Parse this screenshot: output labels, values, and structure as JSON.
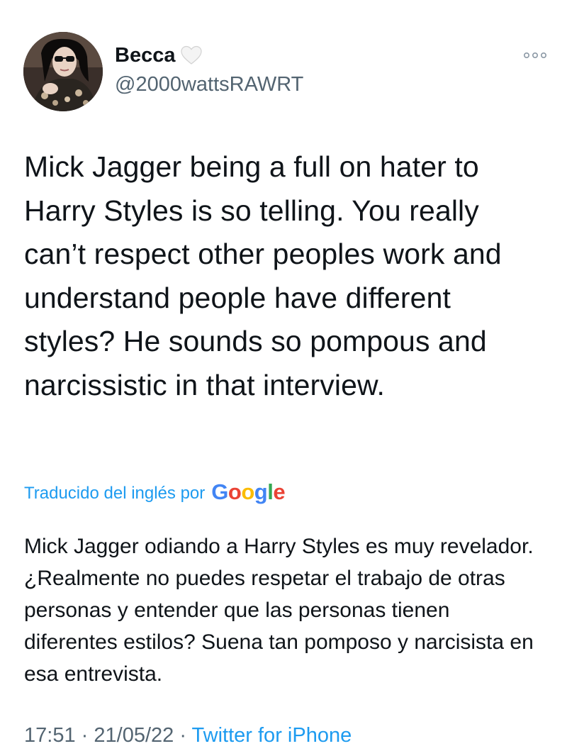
{
  "author": {
    "display_name": "Becca",
    "handle": "@2000wattsRAWRT",
    "name_emoji": "white-heart-icon"
  },
  "tweet": {
    "text": "Mick Jagger being a full on hater to Harry Styles is so telling. You really can’t respect other peoples work and understand people have different styles? He sounds so pompous and narcissistic in that interview."
  },
  "translation": {
    "label": "Traducido del inglés por",
    "provider": [
      "G",
      "o",
      "o",
      "g",
      "l",
      "e"
    ],
    "provider_colors": [
      "#4285F4",
      "#EA4335",
      "#FBBC05",
      "#4285F4",
      "#34A853",
      "#EA4335"
    ],
    "text": "Mick Jagger odiando a Harry Styles es muy revelador. ¿Realmente no puedes respetar el trabajo de otras personas y entender que las personas tienen diferentes estilos? Suena tan pomposo y narcisista en esa entrevista."
  },
  "meta": {
    "time": "17:51",
    "separator": "·",
    "date": "21/05/22",
    "source": "Twitter for iPhone"
  },
  "icons": {
    "more": "more-horizontal-icon"
  },
  "colors": {
    "link": "#1d9bf0",
    "secondary_text": "#536471",
    "primary_text": "#0f1419"
  }
}
